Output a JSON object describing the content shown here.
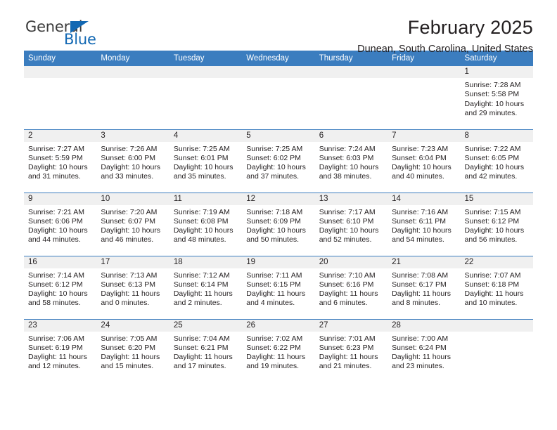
{
  "brand": {
    "name_part1": "General",
    "name_part2": "Blue",
    "triangle_icon": "brand-triangle-icon",
    "colors": {
      "dark": "#3b3b3b",
      "blue": "#1268b3"
    }
  },
  "header": {
    "title": "February 2025",
    "subtitle": "Dunean, South Carolina, United States"
  },
  "theme": {
    "header_bg": "#3b7dbf",
    "row_divider": "#3b7dbf",
    "daynum_bg": "#f0f0f0",
    "text": "#231f20"
  },
  "calendar": {
    "weekday_headers": [
      "Sunday",
      "Monday",
      "Tuesday",
      "Wednesday",
      "Thursday",
      "Friday",
      "Saturday"
    ],
    "labels": {
      "sunrise": "Sunrise:",
      "sunset": "Sunset:",
      "daylight": "Daylight:"
    },
    "weeks": [
      [
        {
          "empty": true
        },
        {
          "empty": true
        },
        {
          "empty": true
        },
        {
          "empty": true
        },
        {
          "empty": true
        },
        {
          "empty": true
        },
        {
          "day": "1",
          "sunrise": "Sunrise: 7:28 AM",
          "sunset": "Sunset: 5:58 PM",
          "daylight_line1": "Daylight: 10 hours",
          "daylight_line2": "and 29 minutes."
        }
      ],
      [
        {
          "day": "2",
          "sunrise": "Sunrise: 7:27 AM",
          "sunset": "Sunset: 5:59 PM",
          "daylight_line1": "Daylight: 10 hours",
          "daylight_line2": "and 31 minutes."
        },
        {
          "day": "3",
          "sunrise": "Sunrise: 7:26 AM",
          "sunset": "Sunset: 6:00 PM",
          "daylight_line1": "Daylight: 10 hours",
          "daylight_line2": "and 33 minutes."
        },
        {
          "day": "4",
          "sunrise": "Sunrise: 7:25 AM",
          "sunset": "Sunset: 6:01 PM",
          "daylight_line1": "Daylight: 10 hours",
          "daylight_line2": "and 35 minutes."
        },
        {
          "day": "5",
          "sunrise": "Sunrise: 7:25 AM",
          "sunset": "Sunset: 6:02 PM",
          "daylight_line1": "Daylight: 10 hours",
          "daylight_line2": "and 37 minutes."
        },
        {
          "day": "6",
          "sunrise": "Sunrise: 7:24 AM",
          "sunset": "Sunset: 6:03 PM",
          "daylight_line1": "Daylight: 10 hours",
          "daylight_line2": "and 38 minutes."
        },
        {
          "day": "7",
          "sunrise": "Sunrise: 7:23 AM",
          "sunset": "Sunset: 6:04 PM",
          "daylight_line1": "Daylight: 10 hours",
          "daylight_line2": "and 40 minutes."
        },
        {
          "day": "8",
          "sunrise": "Sunrise: 7:22 AM",
          "sunset": "Sunset: 6:05 PM",
          "daylight_line1": "Daylight: 10 hours",
          "daylight_line2": "and 42 minutes."
        }
      ],
      [
        {
          "day": "9",
          "sunrise": "Sunrise: 7:21 AM",
          "sunset": "Sunset: 6:06 PM",
          "daylight_line1": "Daylight: 10 hours",
          "daylight_line2": "and 44 minutes."
        },
        {
          "day": "10",
          "sunrise": "Sunrise: 7:20 AM",
          "sunset": "Sunset: 6:07 PM",
          "daylight_line1": "Daylight: 10 hours",
          "daylight_line2": "and 46 minutes."
        },
        {
          "day": "11",
          "sunrise": "Sunrise: 7:19 AM",
          "sunset": "Sunset: 6:08 PM",
          "daylight_line1": "Daylight: 10 hours",
          "daylight_line2": "and 48 minutes."
        },
        {
          "day": "12",
          "sunrise": "Sunrise: 7:18 AM",
          "sunset": "Sunset: 6:09 PM",
          "daylight_line1": "Daylight: 10 hours",
          "daylight_line2": "and 50 minutes."
        },
        {
          "day": "13",
          "sunrise": "Sunrise: 7:17 AM",
          "sunset": "Sunset: 6:10 PM",
          "daylight_line1": "Daylight: 10 hours",
          "daylight_line2": "and 52 minutes."
        },
        {
          "day": "14",
          "sunrise": "Sunrise: 7:16 AM",
          "sunset": "Sunset: 6:11 PM",
          "daylight_line1": "Daylight: 10 hours",
          "daylight_line2": "and 54 minutes."
        },
        {
          "day": "15",
          "sunrise": "Sunrise: 7:15 AM",
          "sunset": "Sunset: 6:12 PM",
          "daylight_line1": "Daylight: 10 hours",
          "daylight_line2": "and 56 minutes."
        }
      ],
      [
        {
          "day": "16",
          "sunrise": "Sunrise: 7:14 AM",
          "sunset": "Sunset: 6:12 PM",
          "daylight_line1": "Daylight: 10 hours",
          "daylight_line2": "and 58 minutes."
        },
        {
          "day": "17",
          "sunrise": "Sunrise: 7:13 AM",
          "sunset": "Sunset: 6:13 PM",
          "daylight_line1": "Daylight: 11 hours",
          "daylight_line2": "and 0 minutes."
        },
        {
          "day": "18",
          "sunrise": "Sunrise: 7:12 AM",
          "sunset": "Sunset: 6:14 PM",
          "daylight_line1": "Daylight: 11 hours",
          "daylight_line2": "and 2 minutes."
        },
        {
          "day": "19",
          "sunrise": "Sunrise: 7:11 AM",
          "sunset": "Sunset: 6:15 PM",
          "daylight_line1": "Daylight: 11 hours",
          "daylight_line2": "and 4 minutes."
        },
        {
          "day": "20",
          "sunrise": "Sunrise: 7:10 AM",
          "sunset": "Sunset: 6:16 PM",
          "daylight_line1": "Daylight: 11 hours",
          "daylight_line2": "and 6 minutes."
        },
        {
          "day": "21",
          "sunrise": "Sunrise: 7:08 AM",
          "sunset": "Sunset: 6:17 PM",
          "daylight_line1": "Daylight: 11 hours",
          "daylight_line2": "and 8 minutes."
        },
        {
          "day": "22",
          "sunrise": "Sunrise: 7:07 AM",
          "sunset": "Sunset: 6:18 PM",
          "daylight_line1": "Daylight: 11 hours",
          "daylight_line2": "and 10 minutes."
        }
      ],
      [
        {
          "day": "23",
          "sunrise": "Sunrise: 7:06 AM",
          "sunset": "Sunset: 6:19 PM",
          "daylight_line1": "Daylight: 11 hours",
          "daylight_line2": "and 12 minutes."
        },
        {
          "day": "24",
          "sunrise": "Sunrise: 7:05 AM",
          "sunset": "Sunset: 6:20 PM",
          "daylight_line1": "Daylight: 11 hours",
          "daylight_line2": "and 15 minutes."
        },
        {
          "day": "25",
          "sunrise": "Sunrise: 7:04 AM",
          "sunset": "Sunset: 6:21 PM",
          "daylight_line1": "Daylight: 11 hours",
          "daylight_line2": "and 17 minutes."
        },
        {
          "day": "26",
          "sunrise": "Sunrise: 7:02 AM",
          "sunset": "Sunset: 6:22 PM",
          "daylight_line1": "Daylight: 11 hours",
          "daylight_line2": "and 19 minutes."
        },
        {
          "day": "27",
          "sunrise": "Sunrise: 7:01 AM",
          "sunset": "Sunset: 6:23 PM",
          "daylight_line1": "Daylight: 11 hours",
          "daylight_line2": "and 21 minutes."
        },
        {
          "day": "28",
          "sunrise": "Sunrise: 7:00 AM",
          "sunset": "Sunset: 6:24 PM",
          "daylight_line1": "Daylight: 11 hours",
          "daylight_line2": "and 23 minutes."
        },
        {
          "empty": true
        }
      ]
    ]
  }
}
